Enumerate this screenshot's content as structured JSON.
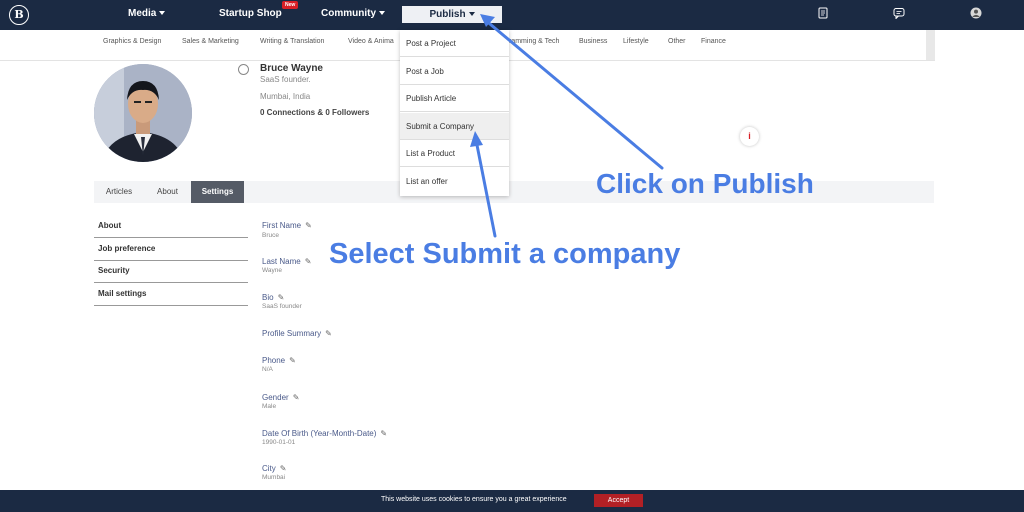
{
  "nav": {
    "logo": "B",
    "media": "Media",
    "startup_shop": "Startup Shop",
    "new_badge": "New",
    "community": "Community",
    "publish": "Publish"
  },
  "categories": [
    "Graphics & Design",
    "Sales & Marketing",
    "Writing & Translation",
    "Video & Anima",
    "ramming & Tech",
    "Business",
    "Lifestyle",
    "Other",
    "Finance"
  ],
  "profile": {
    "name": "Bruce Wayne",
    "description": "SaaS founder.",
    "location": "Mumbai, India",
    "connections": "0 Connections & 0 Followers"
  },
  "info_badge": "i",
  "tabs": [
    "Articles",
    "About",
    "Settings"
  ],
  "side_menu": [
    "About",
    "Job preference",
    "Security",
    "Mail settings"
  ],
  "fields": [
    {
      "label": "First Name",
      "value": "Bruce"
    },
    {
      "label": "Last Name",
      "value": "Wayne"
    },
    {
      "label": "Bio",
      "value": "SaaS founder"
    },
    {
      "label": "Profile Summary",
      "value": ""
    },
    {
      "label": "Phone",
      "value": "N/A"
    },
    {
      "label": "Gender",
      "value": "Male"
    },
    {
      "label": "Date Of Birth (Year-Month-Date)",
      "value": "1990-01-01"
    },
    {
      "label": "City",
      "value": "Mumbai"
    }
  ],
  "publish_menu": [
    "Post a Project",
    "Post a Job",
    "Publish Article",
    "Submit a Company",
    "List a Product",
    "List an offer"
  ],
  "annotations": {
    "click_publish": "Click on Publish",
    "select_submit": "Select Submit a company"
  },
  "cookie": {
    "text": "This website uses cookies to ensure you a great experience",
    "accept": "Accept"
  },
  "colors": {
    "navbar": "#1b2a43",
    "annotation": "#4a7de3",
    "accept": "#b22025",
    "badge": "#d81f26"
  }
}
